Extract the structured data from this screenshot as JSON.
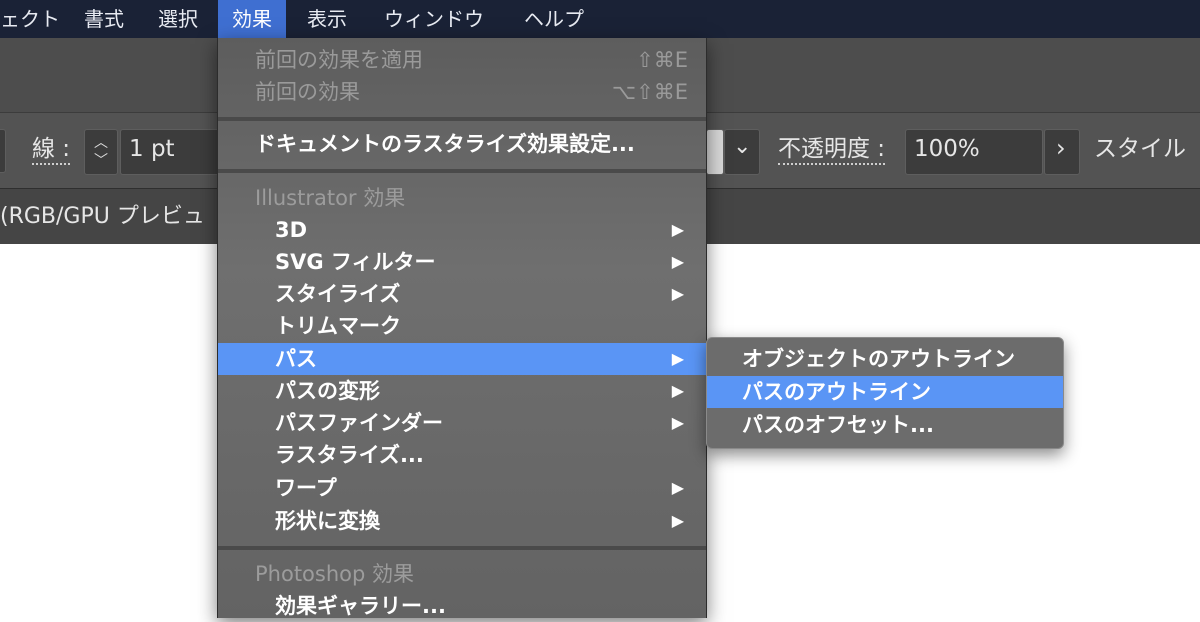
{
  "menubar": {
    "items": [
      "ェクト",
      "書式",
      "選択",
      "効果",
      "表示",
      "ウィンドウ",
      "ヘルプ"
    ],
    "active_index": 3
  },
  "control_bar": {
    "stroke_label": "線 :",
    "stroke_value": "1 pt",
    "opacity_label": "不透明度 :",
    "opacity_value": "100%",
    "style_label": "スタイル",
    "chevron_down": "⌄",
    "chevron_right": "›",
    "stepper_up": "︿",
    "stepper_down": "﹀"
  },
  "doc_tab": {
    "label": "(RGB/GPU プレビュ"
  },
  "effect_menu": {
    "apply_last": {
      "label": "前回の効果を適用",
      "shortcut": "⇧⌘E"
    },
    "last_effect": {
      "label": "前回の効果",
      "shortcut": "⌥⇧⌘E"
    },
    "raster_settings": "ドキュメントのラスタライズ効果設定...",
    "illustrator_header": "Illustrator 効果",
    "items": [
      {
        "label": "3D",
        "submenu": true
      },
      {
        "label": "SVG フィルター",
        "submenu": true
      },
      {
        "label": "スタイライズ",
        "submenu": true
      },
      {
        "label": "トリムマーク",
        "submenu": false
      },
      {
        "label": "パス",
        "submenu": true
      },
      {
        "label": "パスの変形",
        "submenu": true
      },
      {
        "label": "パスファインダー",
        "submenu": true
      },
      {
        "label": "ラスタライズ...",
        "submenu": false
      },
      {
        "label": "ワープ",
        "submenu": true
      },
      {
        "label": "形状に変換",
        "submenu": true
      }
    ],
    "arrow_glyph": "▶",
    "photoshop_header": "Photoshop 効果",
    "gallery": "効果ギャラリー..."
  },
  "path_submenu": {
    "items": [
      "オブジェクトのアウトライン",
      "パスのアウトライン",
      "パスのオフセット..."
    ],
    "highlighted_index": 1
  },
  "colors": {
    "menubar_bg": "#1a2236",
    "active_menu": "#3f6fd1",
    "highlight": "#5a95f5"
  }
}
